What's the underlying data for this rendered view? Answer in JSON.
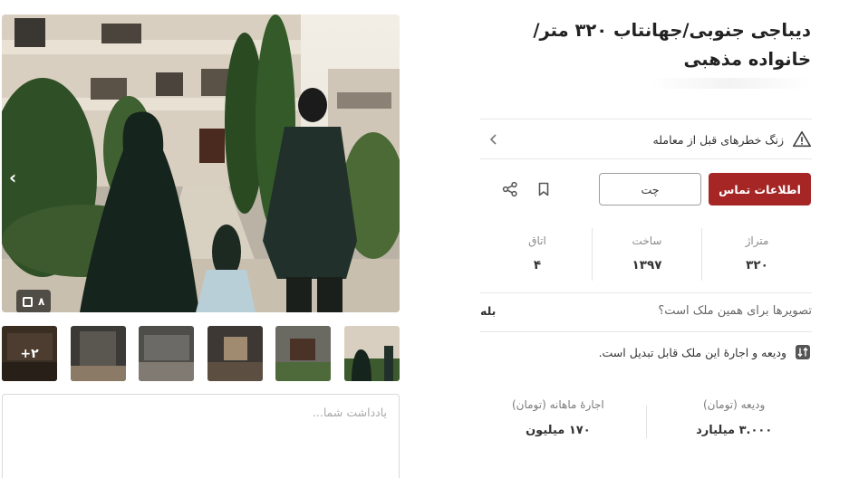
{
  "gallery": {
    "photo_count": "۸",
    "prev_arrow": "‹",
    "more_thumbs": "+۲",
    "fullscreen_icon": "fullscreen-icon"
  },
  "note": {
    "placeholder": "یادداشت شما..."
  },
  "listing": {
    "title": "دیباجی جنوبی/جهانتاب ۳۲۰ متر/خانواده مذهبی",
    "warning_label": "زنگ خطرهای قبل از معامله",
    "contact_button": "اطلاعات تماس",
    "chat_button": "چت",
    "stats": {
      "area_label": "متراژ",
      "area_value": "۳۲۰",
      "year_label": "ساخت",
      "year_value": "۱۳۹۷",
      "rooms_label": "اتاق",
      "rooms_value": "۴"
    },
    "photos_question": "تصویرها برای همین ملک است؟",
    "photos_answer": "بله",
    "convertible_text": "ودیعه و اجارهٔ این ملک قابل تبدیل است.",
    "deposit_label": "ودیعه (تومان)",
    "deposit_value": "۳.۰۰۰ میلیارد",
    "rent_label": "اجارهٔ ماهانه (تومان)",
    "rent_value": "۱۷۰ میلیون"
  },
  "colors": {
    "accent": "#a62626",
    "divider": "#e6e6e6"
  }
}
